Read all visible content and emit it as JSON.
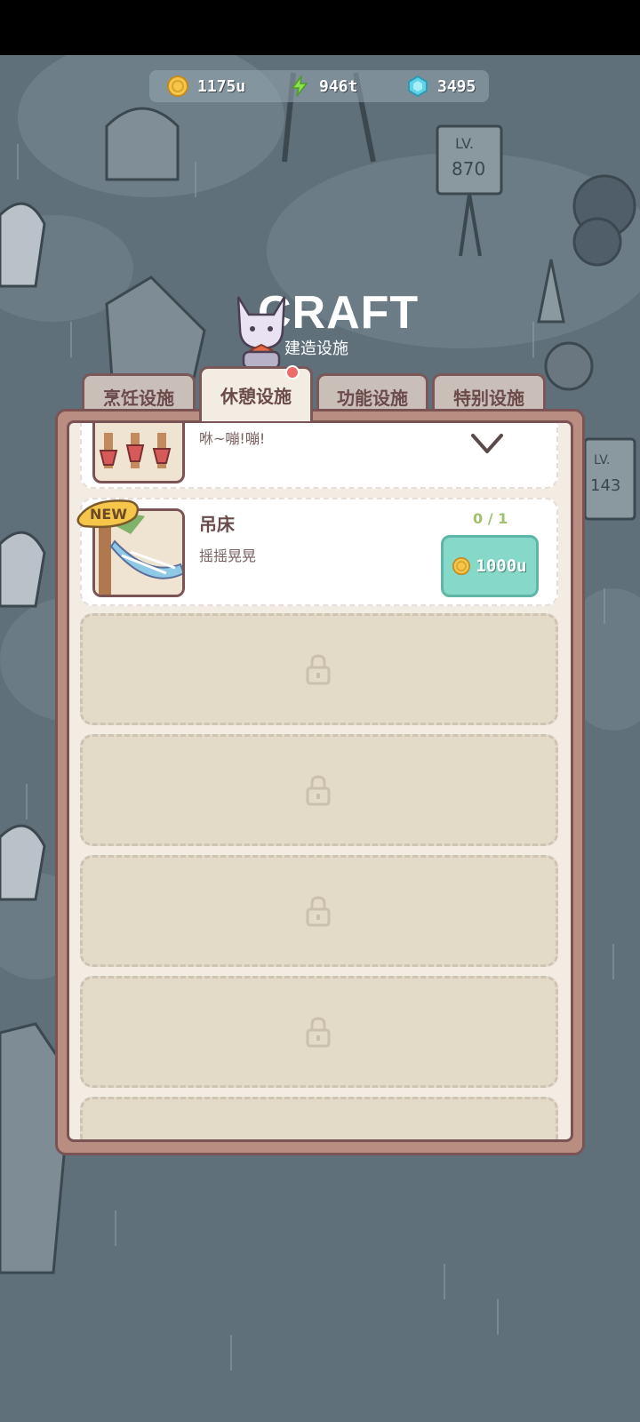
{
  "currency": {
    "coins": "1175u",
    "energy": "946t",
    "gems": "3495"
  },
  "header": {
    "title": "CRAFT",
    "subtitle": "建造设施"
  },
  "tabs": [
    {
      "label": "烹饪设施",
      "active": false
    },
    {
      "label": "休憩设施",
      "active": true,
      "has_notification": true
    },
    {
      "label": "功能设施",
      "active": false
    },
    {
      "label": "特别设施",
      "active": false
    }
  ],
  "items": [
    {
      "name": "",
      "desc": "咻~嘣!嘣!",
      "status": "owned"
    },
    {
      "name": "吊床",
      "desc": "摇摇晃晃",
      "count": "0 / 1",
      "price": "1000u",
      "badge": "NEW"
    }
  ],
  "background_signs": [
    "LV.",
    "870",
    "LV.",
    "143"
  ],
  "colors": {
    "accent_teal": "#86d8c8",
    "tab_border": "#7a5454",
    "notification": "#ef6b68",
    "count_green": "#9fc16f"
  }
}
